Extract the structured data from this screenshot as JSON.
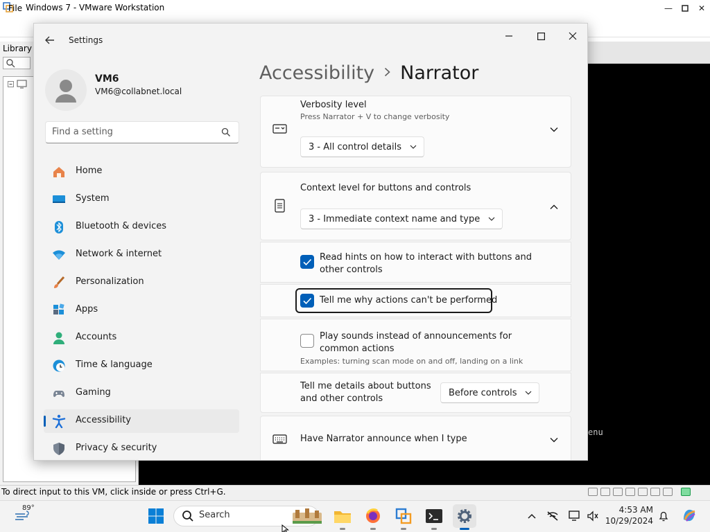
{
  "vmware": {
    "title": "Windows 7 - VMware Workstation",
    "menu_file": "File",
    "library_label": "Library",
    "status_text": "To direct input to this VM, click inside or press Ctrl+G.",
    "guest_text": "enu"
  },
  "settings": {
    "window_title": "Settings",
    "user": {
      "name": "VM6",
      "email": "VM6@collabnet.local"
    },
    "search_placeholder": "Find a setting",
    "nav": [
      {
        "label": "Home",
        "icon": "home-icon"
      },
      {
        "label": "System",
        "icon": "system-icon"
      },
      {
        "label": "Bluetooth & devices",
        "icon": "bluetooth-icon"
      },
      {
        "label": "Network & internet",
        "icon": "network-icon"
      },
      {
        "label": "Personalization",
        "icon": "brush-icon"
      },
      {
        "label": "Apps",
        "icon": "apps-icon"
      },
      {
        "label": "Accounts",
        "icon": "accounts-icon"
      },
      {
        "label": "Time & language",
        "icon": "clock-globe-icon"
      },
      {
        "label": "Gaming",
        "icon": "gamepad-icon"
      },
      {
        "label": "Accessibility",
        "icon": "accessibility-icon",
        "selected": true
      },
      {
        "label": "Privacy & security",
        "icon": "shield-icon"
      }
    ],
    "breadcrumb": {
      "parent": "Accessibility",
      "current": "Narrator"
    },
    "verbosity": {
      "title": "Verbosity level",
      "subtitle": "Press Narrator + V to change verbosity",
      "value": "3 - All control details"
    },
    "context": {
      "title": "Context level for buttons and controls",
      "value": "3 - Immediate context name and type",
      "options": [
        {
          "label_1": "Read hints on how to interact with buttons and",
          "label_2": "other controls",
          "checked": true
        },
        {
          "label": "Tell me why actions can't be performed",
          "checked": true,
          "focused": true
        },
        {
          "label_1": "Play sounds instead of announcements for",
          "label_2": "common actions",
          "note": "Examples: turning scan mode on and off, landing on a link",
          "checked": false
        }
      ],
      "details": {
        "label_1": "Tell me details about buttons",
        "label_2": "and other controls",
        "value": "Before controls"
      }
    },
    "announce": {
      "title": "Have Narrator announce when I type"
    }
  },
  "taskbar": {
    "weather_temp": "89°",
    "search_placeholder": "Search",
    "time": "4:53 AM",
    "date": "10/29/2024"
  },
  "colors": {
    "accent": "#005fb8",
    "guest_bg": "#000000",
    "window_bg": "#f3f3f3"
  }
}
